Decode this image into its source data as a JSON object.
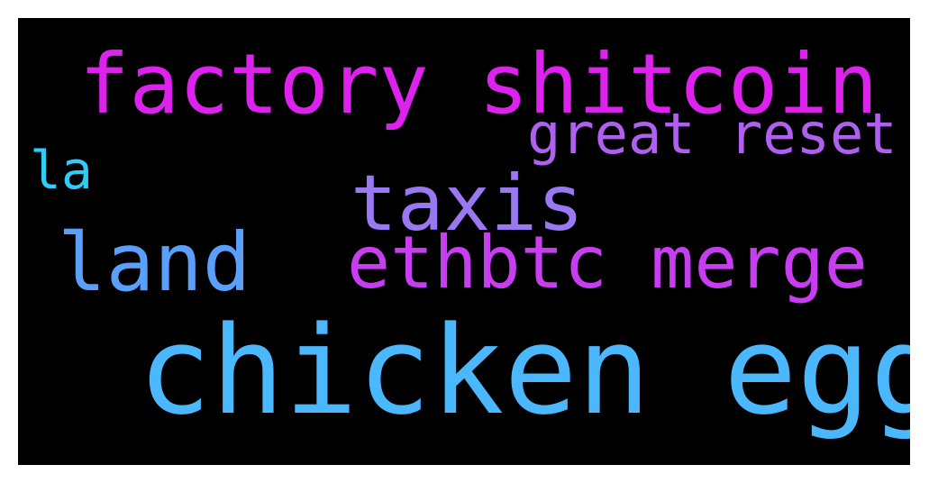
{
  "words": [
    {
      "text": "factory shitcoin",
      "color": "#dd22ee"
    },
    {
      "text": "great reset",
      "color": "#b060f0"
    },
    {
      "text": "la",
      "color": "#30ccf6"
    },
    {
      "text": "taxis",
      "color": "#9a78f2"
    },
    {
      "text": "land",
      "color": "#5aa0fb"
    },
    {
      "text": "ethbtc merge",
      "color": "#c73ef0"
    },
    {
      "text": "chicken egg",
      "color": "#4bb7fd"
    }
  ]
}
